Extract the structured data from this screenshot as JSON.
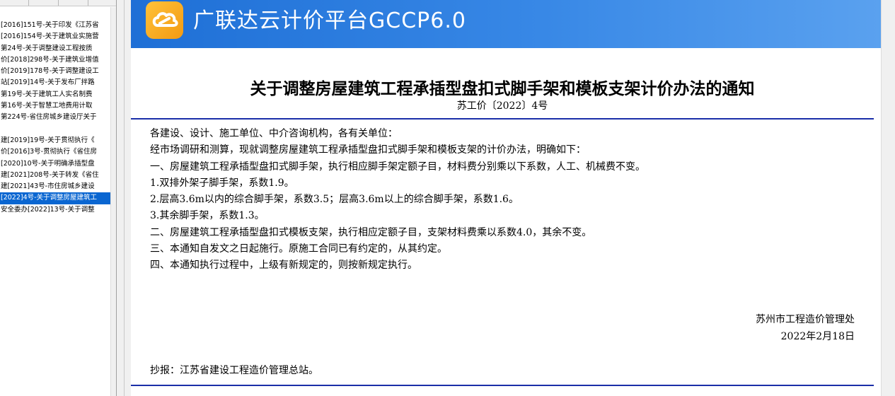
{
  "left_pane": {
    "documents": [
      "[2016]151号-关于印发《江苏省",
      "[2016]154号-关于建筑业实施营",
      "第24号-关于调整建设工程按质",
      "价[2018]298号-关于建筑业增值",
      "价[2019]178号-关于调整建设工",
      "站[2019]14号-关于发布厂拌路",
      "第19号-关于建筑工人实名制费",
      "第16号-关于智慧工地费用计取",
      "第224号-省住房城乡建设厅关于",
      "",
      "建[2019]19号-关于贯彻执行《",
      "价[2016]3号-贯彻执行《省住房",
      "[2020]10号-关于明确承插型盘",
      "建[2021]208号-关于转发《省住",
      "建[2021]43号-市住房城乡建设",
      "[2022]4号-关于调整房屋建筑工",
      "安全委办[2022]13号-关于调整"
    ],
    "selected_index": 15
  },
  "banner": {
    "logo_icon": "cloud-link-logo-icon",
    "title": "广联达云计价平台GCCP6.0"
  },
  "notice": {
    "title": "关于调整房屋建筑工程承插型盘扣式脚手架和模板支架计价办法的通知",
    "number": "苏工价〔2022〕4号",
    "paragraphs": [
      "各建设、设计、施工单位、中介咨询机构，各有关单位：",
      "经市场调研和测算，现就调整房屋建筑工程承插型盘扣式脚手架和模板支架的计价办法，明确如下：",
      "一、房屋建筑工程承插型盘扣式脚手架，执行相应脚手架定额子目，材料费分别乘以下系数，人工、机械费不变。",
      "1.双排外架子脚手架，系数1.9。",
      "2.层高3.6m以内的综合脚手架，系数3.5；层高3.6m以上的综合脚手架，系数1.6。",
      "3.其余脚手架，系数1.3。",
      "二、房屋建筑工程承插型盘扣式模板支架，执行相应定额子目，支架材料费乘以系数4.0，其余不变。",
      "三、本通知自发文之日起施行。原施工合同已有约定的，从其约定。",
      "四、本通知执行过程中，上级有新规定的，则按新规定执行。"
    ],
    "issuer": "苏州市工程造价管理处",
    "date": "2022年2月18日",
    "cc": "抄报：江苏省建设工程造价管理总站。"
  },
  "colors": {
    "selection": "#0a66d1",
    "banner_start": "#1e6fd6",
    "banner_end": "#5aa1ef",
    "logo": "#f39a12",
    "rule": "#1a2ea8"
  }
}
